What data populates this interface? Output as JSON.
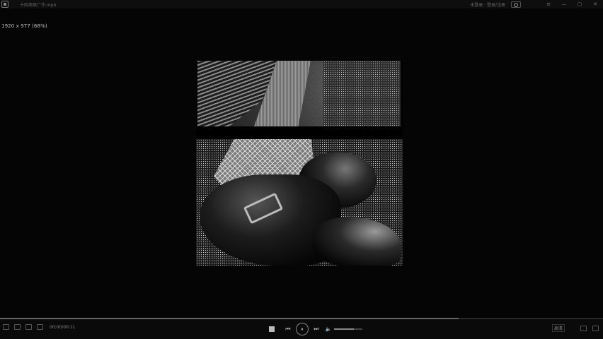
{
  "window": {
    "title": "十四周原厂作.mp4",
    "user": "未登录 · 登录/注册",
    "controls": [
      "—",
      "▢",
      "✕"
    ],
    "menu_icon": "≡"
  },
  "video": {
    "resolution_label": "1920 x 977 (68%)"
  },
  "player": {
    "time": "00:00/00:11",
    "progress": 0.76,
    "volume": 0.7,
    "quality": "高清",
    "icons": {
      "stop": "stop-icon",
      "prev": "⏮",
      "play": "⏸",
      "next": "⏭",
      "volume": "🔈"
    }
  }
}
